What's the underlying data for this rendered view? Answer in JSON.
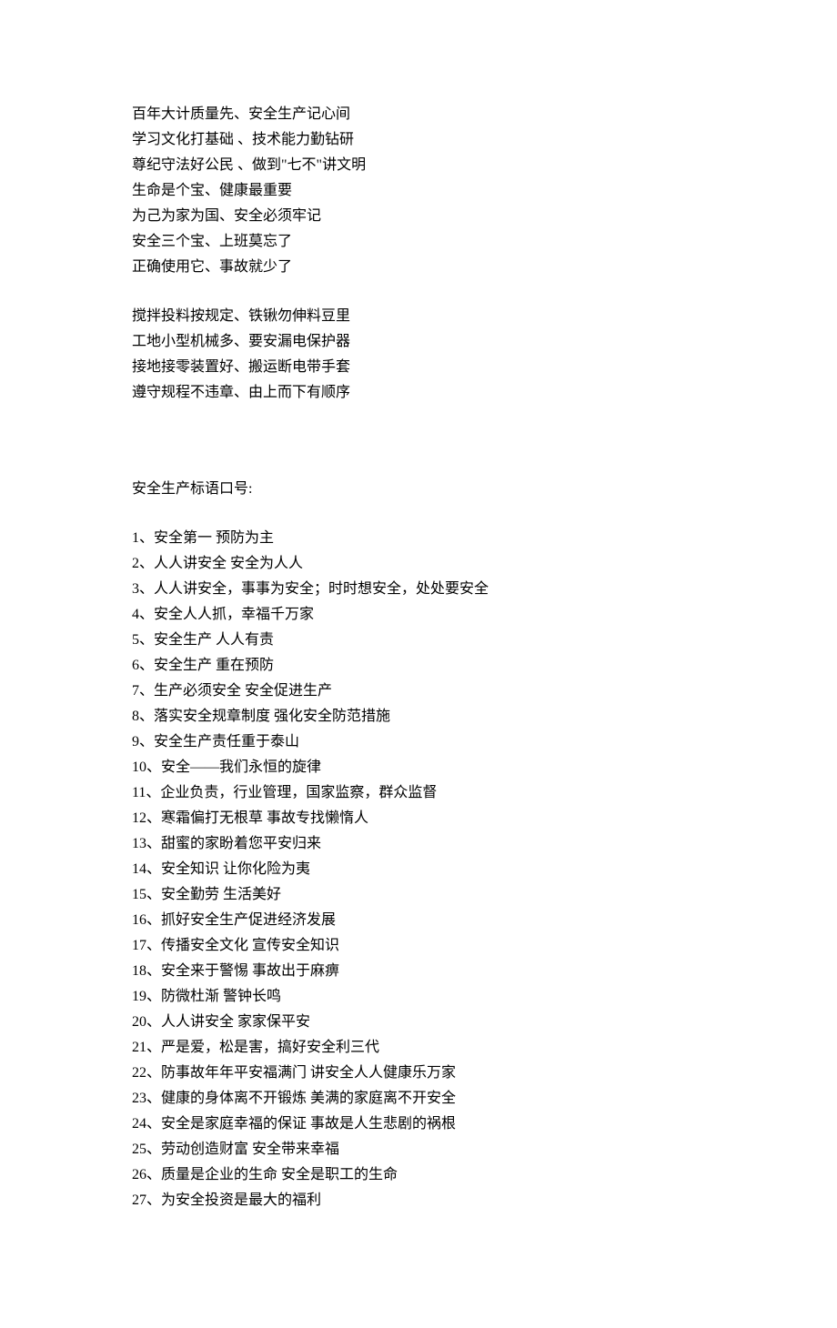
{
  "section1": [
    "百年大计质量先、安全生产记心间",
    "学习文化打基础 、技术能力勤钻研",
    "尊纪守法好公民 、做到\"七不\"讲文明",
    "生命是个宝、健康最重要",
    "为己为家为国、安全必须牢记",
    "安全三个宝、上班莫忘了",
    "正确使用它、事故就少了"
  ],
  "section2": [
    "搅拌投料按规定、铁锹勿伸料豆里",
    "工地小型机械多、要安漏电保护器",
    "接地接零装置好、搬运断电带手套",
    "遵守规程不违章、由上而下有顺序"
  ],
  "headline": "安全生产标语口号:",
  "slogans": [
    "1、安全第一 预防为主",
    "2、人人讲安全 安全为人人",
    "3、人人讲安全，事事为安全；时时想安全，处处要安全",
    "4、安全人人抓，幸福千万家",
    "5、安全生产 人人有责",
    "6、安全生产 重在预防",
    "7、生产必须安全 安全促进生产",
    "8、落实安全规章制度 强化安全防范措施",
    "9、安全生产责任重于泰山",
    "10、安全——我们永恒的旋律",
    "11、企业负责，行业管理，国家监察，群众监督",
    "12、寒霜偏打无根草 事故专找懒惰人",
    "13、甜蜜的家盼着您平安归来",
    "14、安全知识 让你化险为夷",
    "15、安全勤劳 生活美好",
    "16、抓好安全生产促进经济发展",
    "17、传播安全文化 宣传安全知识",
    "18、安全来于警惕 事故出于麻痹",
    "19、防微杜渐 警钟长鸣",
    "20、人人讲安全 家家保平安",
    "21、严是爱，松是害，搞好安全利三代",
    "22、防事故年年平安福满门 讲安全人人健康乐万家",
    "23、健康的身体离不开锻炼 美满的家庭离不开安全",
    "24、安全是家庭幸福的保证 事故是人生悲剧的祸根",
    "25、劳动创造财富 安全带来幸福",
    "26、质量是企业的生命 安全是职工的生命",
    "27、为安全投资是最大的福利"
  ]
}
